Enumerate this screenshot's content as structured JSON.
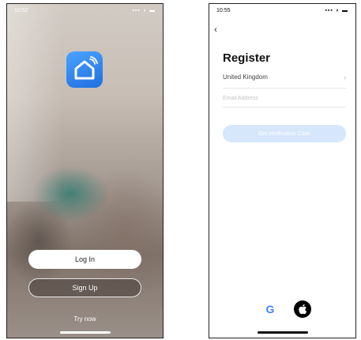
{
  "left_phone": {
    "status_time": "10:52",
    "login_label": "Log In",
    "signup_label": "Sign Up",
    "try_now_label": "Try now"
  },
  "right_phone": {
    "status_time": "10:55",
    "back_icon": "chevron-left-icon",
    "title": "Register",
    "country": "United Kingdom",
    "email_placeholder": "Email Address",
    "get_code_label": "Get Verification Code",
    "social": [
      "google-icon",
      "apple-icon"
    ]
  },
  "colors": {
    "app_icon": "#2f86f0",
    "button_disabled": "#d6e6fb",
    "google_blue": "#4285F4"
  }
}
